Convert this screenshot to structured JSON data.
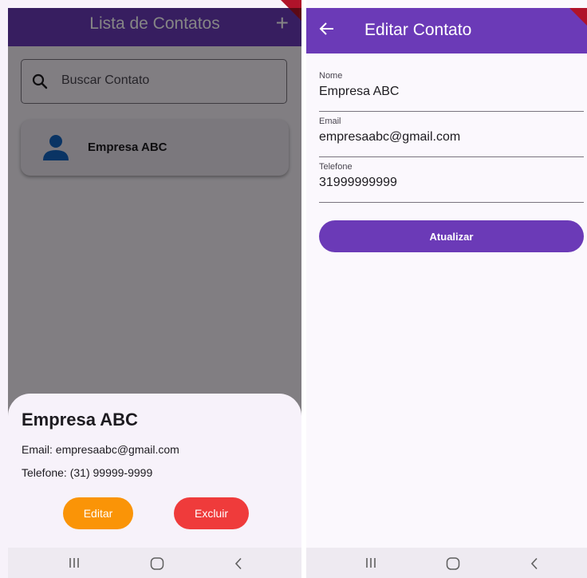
{
  "left_screen": {
    "appbar": {
      "title": "Lista de Contatos",
      "add_icon": "plus-icon"
    },
    "search": {
      "placeholder": "Buscar Contato",
      "icon": "search-icon"
    },
    "contacts": [
      {
        "name": "Empresa ABC",
        "icon": "person-icon"
      }
    ],
    "sheet": {
      "title": "Empresa ABC",
      "email_line": "Email: empresaabc@gmail.com",
      "phone_line": "Telefone: (31) 99999-9999",
      "edit_label": "Editar",
      "delete_label": "Excluir"
    }
  },
  "right_screen": {
    "appbar": {
      "title": "Editar Contato",
      "back_icon": "arrow-left-icon"
    },
    "fields": [
      {
        "label": "Nome",
        "value": "Empresa ABC"
      },
      {
        "label": "Email",
        "value": "empresaabc@gmail.com"
      },
      {
        "label": "Telefone",
        "value": "31999999999"
      }
    ],
    "update_label": "Atualizar"
  },
  "system_nav": {
    "icons": [
      "recents-icon",
      "home-icon",
      "back-icon"
    ]
  },
  "colors": {
    "primary": "#6b3ab7",
    "edit_button": "#fa9407",
    "delete_button": "#ef3b3b",
    "surface": "#f7f2fa"
  }
}
